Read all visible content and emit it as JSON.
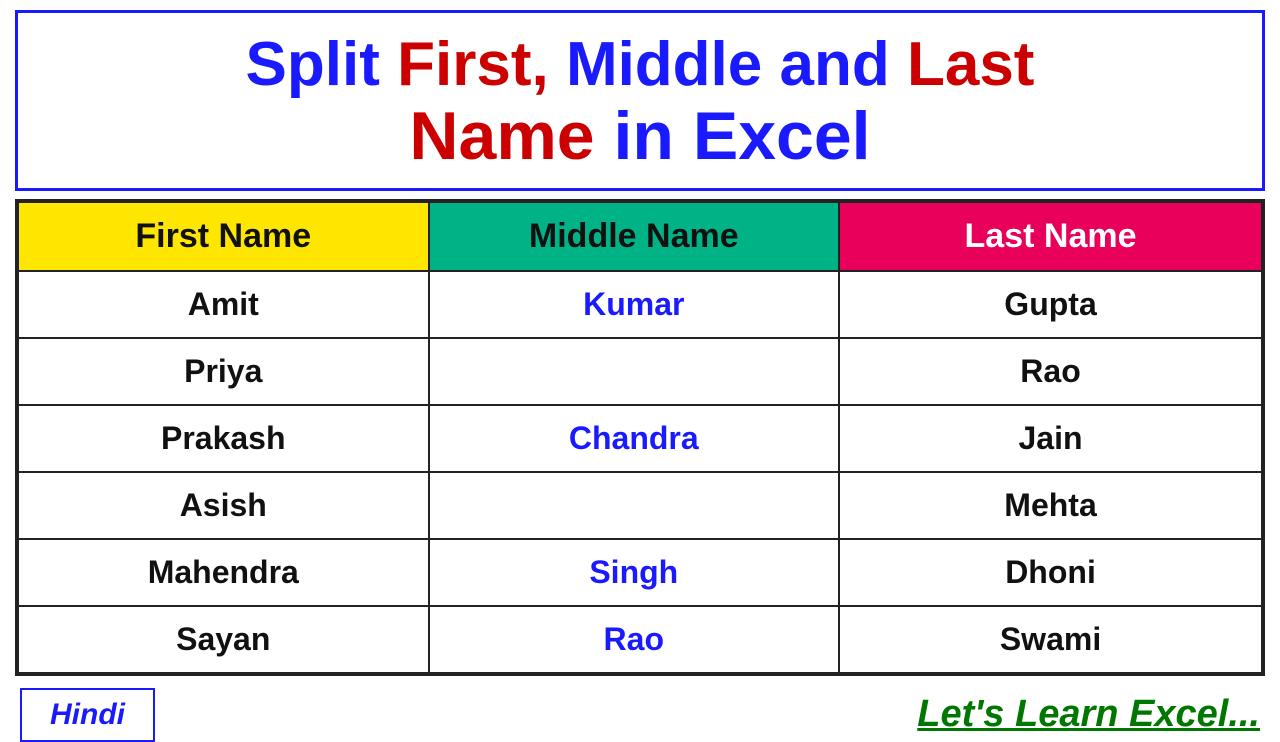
{
  "title": {
    "line1_split": "Split",
    "line1_first": "First,",
    "line1_middle": "Middle",
    "line1_and": "and",
    "line1_last": "Last",
    "line2_name": "Name",
    "line2_in": "in",
    "line2_excel": "Excel"
  },
  "table": {
    "headers": {
      "first": "First Name",
      "middle": "Middle Name",
      "last": "Last Name"
    },
    "rows": [
      {
        "first": "Amit",
        "middle": "Kumar",
        "middle_blue": true,
        "last": "Gupta"
      },
      {
        "first": "Priya",
        "middle": "",
        "middle_blue": false,
        "last": "Rao"
      },
      {
        "first": "Prakash",
        "middle": "Chandra",
        "middle_blue": true,
        "last": "Jain"
      },
      {
        "first": "Asish",
        "middle": "",
        "middle_blue": false,
        "last": "Mehta"
      },
      {
        "first": "Mahendra",
        "middle": "Singh",
        "middle_blue": true,
        "last": "Dhoni"
      },
      {
        "first": "Sayan",
        "middle": "Rao",
        "middle_blue": true,
        "last": "Swami"
      }
    ]
  },
  "footer": {
    "hindi_label": "Hindi",
    "tagline": "Let's Learn Excel..."
  }
}
